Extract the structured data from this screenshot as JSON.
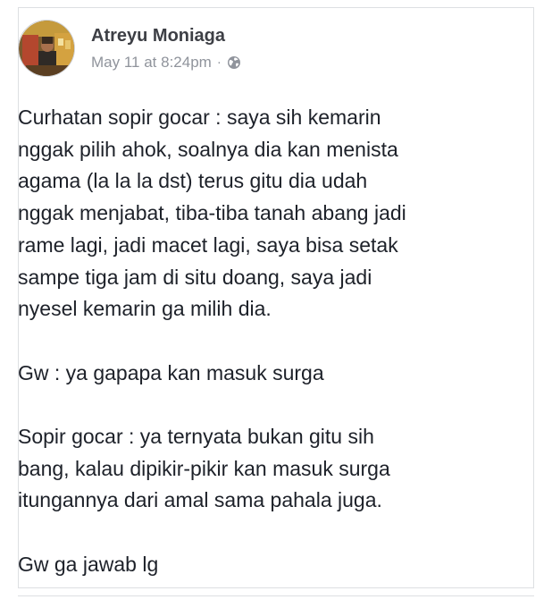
{
  "post": {
    "author": "Atreyu Moniaga",
    "timestamp": "May 11 at 8:24pm",
    "separator": "·",
    "privacy_icon": "globe-icon",
    "avatar_icon": "profile-photo",
    "paragraphs": [
      "Curhatan sopir gocar : saya sih kemarin\nnggak pilih ahok, soalnya dia kan menista\nagama (la la la dst) terus gitu dia udah\nnggak menjabat, tiba-tiba tanah abang jadi\nrame lagi, jadi macet lagi, saya bisa setak\nsampe tiga jam di situ doang, saya jadi\nnyesel kemarin ga milih dia.",
      "Gw : ya gapapa kan masuk surga",
      "Sopir gocar : ya ternyata bukan gitu sih\nbang, kalau dipikir-pikir kan masuk surga\nitungannya dari amal sama pahala juga.",
      "Gw ga jawab lg"
    ]
  },
  "colors": {
    "text": "#1d2129",
    "author": "#3d3f45",
    "meta": "#90949c",
    "border": "#dddfe2"
  }
}
